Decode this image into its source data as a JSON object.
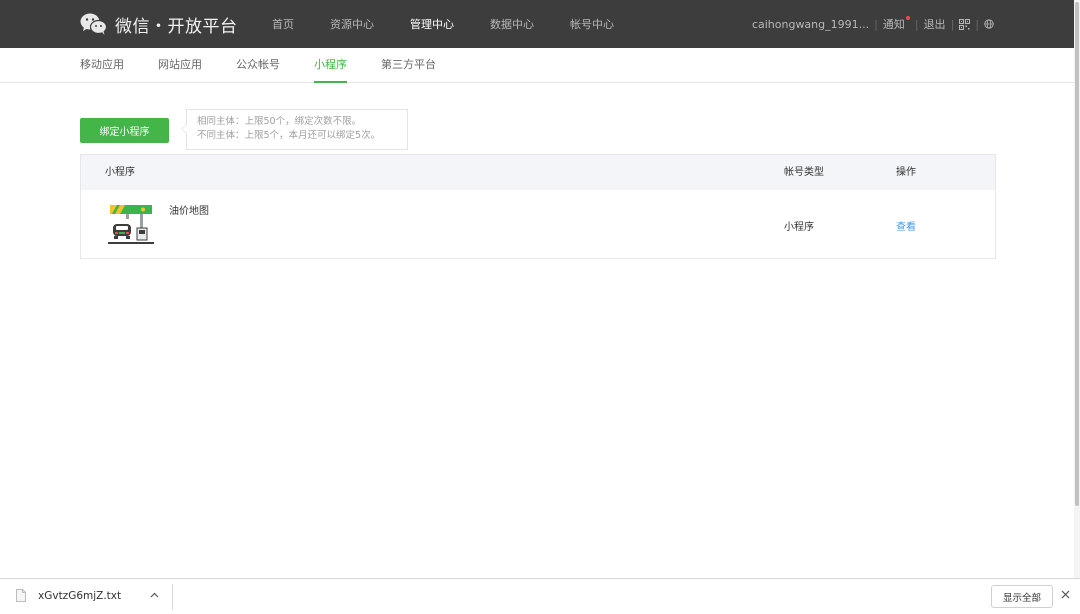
{
  "header": {
    "logo_text": "微信・开放平台",
    "nav": [
      {
        "label": "首页",
        "active": false
      },
      {
        "label": "资源中心",
        "active": false
      },
      {
        "label": "管理中心",
        "active": true
      },
      {
        "label": "数据中心",
        "active": false
      },
      {
        "label": "帐号中心",
        "active": false
      }
    ],
    "user": {
      "name": "caihongwang_1991...",
      "notify": "通知",
      "logout": "退出"
    }
  },
  "subnav": {
    "items": [
      {
        "label": "移动应用",
        "active": false
      },
      {
        "label": "网站应用",
        "active": false
      },
      {
        "label": "公众帐号",
        "active": false
      },
      {
        "label": "小程序",
        "active": true
      },
      {
        "label": "第三方平台",
        "active": false
      }
    ]
  },
  "main": {
    "bind_button": "绑定小程序",
    "tip_lines": [
      "相同主体：上限50个，绑定次数不限。",
      "不同主体：上限5个，本月还可以绑定5次。"
    ],
    "table": {
      "headers": {
        "name": "小程序",
        "type": "帐号类型",
        "action": "操作"
      },
      "rows": [
        {
          "name": "油价地图",
          "type": "小程序",
          "action": "查看",
          "icon": "gas-station-icon"
        }
      ]
    }
  },
  "download_bar": {
    "filename": "xGvtzG6mjZ.txt",
    "show_all": "显示全部"
  },
  "colors": {
    "topbar_bg": "#3d3d3d",
    "accent_green": "#44b549",
    "link_blue": "#459ae9"
  }
}
